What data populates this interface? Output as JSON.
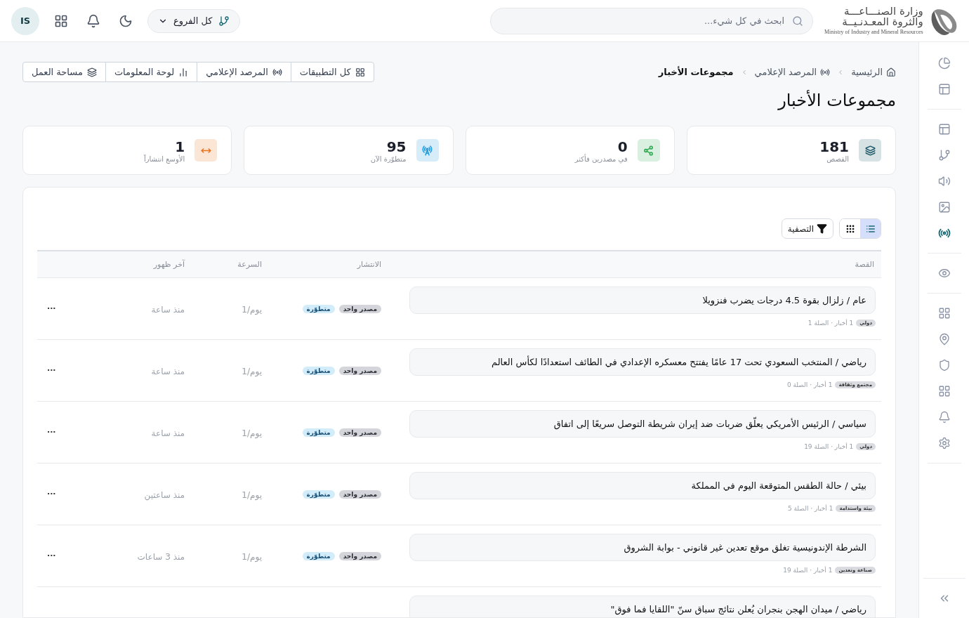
{
  "logo": {
    "line_1": "وزارة الصنـــاعـــة",
    "line_2": "والثروة المعـدنـيــة",
    "english": "Ministry of Industry and Mineral Resources"
  },
  "search": {
    "placeholder": "ابحث في كل شيء..."
  },
  "branch_selector": {
    "value": "كل الفروع"
  },
  "user": {
    "initials": "IS"
  },
  "breadcrumb": [
    {
      "label": "الرئيسية",
      "current": false
    },
    {
      "label": "المرصد الإعلامي",
      "current": false
    },
    {
      "label": "مجموعات الأخبار",
      "current": true
    }
  ],
  "app_links": [
    "كل التطبيقات",
    "المرصد الإعلامي",
    "لوحة المعلومات",
    "مساحة العمل"
  ],
  "page_title": "مجموعات الأخبار",
  "stats": [
    {
      "value": "181",
      "label": "القصص",
      "color": "#1f5c6b"
    },
    {
      "value": "0",
      "label": "في مصدرين فأكثر",
      "color": "#2fa84f"
    },
    {
      "value": "95",
      "label": "متطوّرة الآن",
      "color": "#1e9be0"
    },
    {
      "value": "1",
      "label": "الأوسع انتشاراً",
      "color": "#e8731e"
    }
  ],
  "toolbar": {
    "views": [
      {
        "selected": true
      },
      {
        "selected": false
      }
    ],
    "filter": "التصفية"
  },
  "table": {
    "columns": [
      "القصة",
      "الانتشار",
      "السرعة",
      "آخر ظهور"
    ],
    "rows": [
      {
        "headline": "عام / زلزال بقوة 4.5 درجات يضرب فنزويلا",
        "category": "دولي",
        "meta": "1 أخبار · الصلة 1",
        "tags": [
          {
            "label": "مصدر واحد",
            "kind": "sources"
          },
          {
            "label": "متطوّرة",
            "kind": "trend"
          }
        ],
        "speed": "يوم/1",
        "last_seen": "منذ ساعة",
        "actions": "···"
      },
      {
        "headline": "رياضي / المنتخب السعودي تحت 17 عامًا يفتتح معسكره الإعدادي في الطائف استعدادًا لكأس العالم",
        "category": "مجتمع وثقافة",
        "meta": "1 أخبار · الصلة 0",
        "tags": [
          {
            "label": "مصدر واحد",
            "kind": "sources"
          },
          {
            "label": "متطوّرة",
            "kind": "trend"
          }
        ],
        "speed": "يوم/1",
        "last_seen": "منذ ساعة",
        "actions": "···"
      },
      {
        "headline": "سياسي / الرئيس الأمريكي يعلّق ضربات ضد إيران شريطة التوصل سريعًا إلى اتفاق",
        "category": "دولي",
        "meta": "1 أخبار · الصلة 19",
        "tags": [
          {
            "label": "مصدر واحد",
            "kind": "sources"
          },
          {
            "label": "متطوّرة",
            "kind": "trend"
          }
        ],
        "speed": "يوم/1",
        "last_seen": "منذ ساعة",
        "actions": "···"
      },
      {
        "headline": "بيئي / حالة الطقس المتوقعة اليوم في المملكة",
        "category": "بيئة واستدامة",
        "meta": "1 أخبار · الصلة 5",
        "tags": [
          {
            "label": "مصدر واحد",
            "kind": "sources"
          },
          {
            "label": "متطوّرة",
            "kind": "trend"
          }
        ],
        "speed": "يوم/1",
        "last_seen": "منذ ساعتين",
        "actions": "···"
      },
      {
        "headline": "الشرطة الإندونيسية تغلق موقع تعدين غير قانوني - بوابة الشروق",
        "category": "صناعة وتعدين",
        "meta": "1 أخبار · الصلة 19",
        "tags": [
          {
            "label": "مصدر واحد",
            "kind": "sources"
          },
          {
            "label": "متطوّرة",
            "kind": "trend"
          }
        ],
        "speed": "يوم/1",
        "last_seen": "منذ 3 ساعات",
        "actions": "···"
      },
      {
        "headline": "رياضي / ميدان الهجن بنجران يُعلن نتائج سباق سنّ \"اللقايا فما فوق\""
      }
    ]
  },
  "sidebar": {
    "groups": [
      [
        {
          "selected": false
        },
        {
          "selected": false
        }
      ],
      [
        {
          "selected": false
        },
        {
          "selected": false
        },
        {
          "selected": false
        },
        {
          "selected": false
        },
        {
          "selected": true
        }
      ],
      [
        {
          "selected": false
        }
      ],
      [
        {
          "selected": false
        },
        {
          "selected": false
        },
        {
          "selected": false
        },
        {
          "selected": false
        },
        {
          "selected": false
        },
        {
          "selected": false
        }
      ]
    ]
  }
}
